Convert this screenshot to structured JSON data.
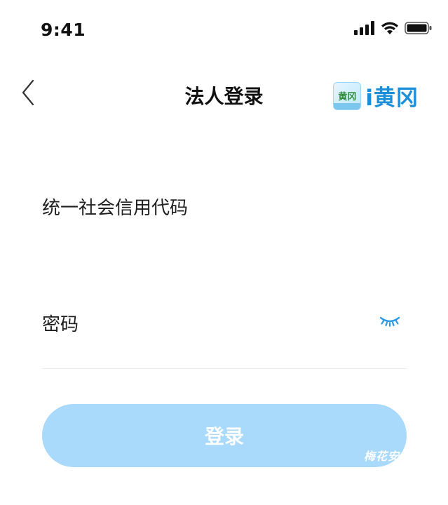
{
  "status_bar": {
    "time": "9:41",
    "icons": [
      "signal-icon",
      "wifi-icon",
      "battery-icon"
    ]
  },
  "nav": {
    "back_icon": "chevron-left-icon",
    "title": "法人登录",
    "brand_badge_text": "黄冈",
    "brand_name": "i黄冈"
  },
  "form": {
    "credit_code": {
      "label": "统一社会信用代码",
      "value": "",
      "placeholder": ""
    },
    "password": {
      "label": "密码",
      "value": "",
      "placeholder": "",
      "toggle_icon": "eye-closed-icon"
    }
  },
  "login_button": {
    "label": "登录",
    "disabled": true
  },
  "watermark": "梅花安卓",
  "colors": {
    "accent": "#1d8fd8",
    "button_disabled": "#a9d9fb",
    "eye_icon": "#2b9be6",
    "divider": "#ececec"
  }
}
